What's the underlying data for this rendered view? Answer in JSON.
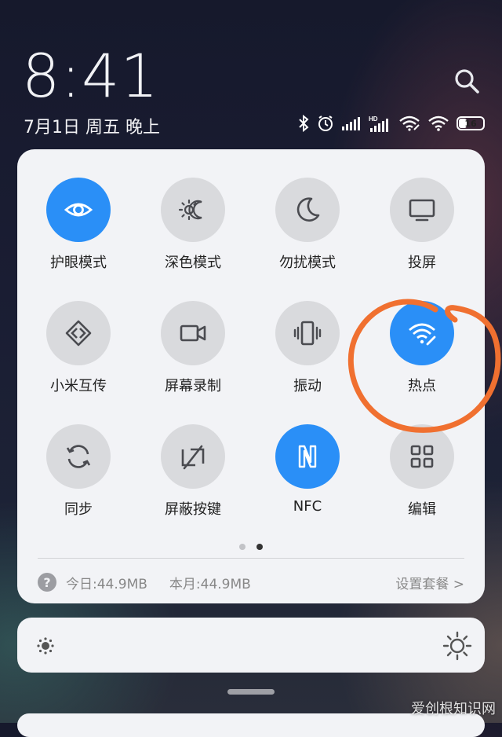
{
  "clock": {
    "time": "8:41",
    "date": "7月1日 周五 晚上"
  },
  "status": {
    "battery": "16",
    "battery_level": 0.16
  },
  "tiles": [
    {
      "id": "eye",
      "label": "护眼模式",
      "active": true,
      "icon": "eye-icon"
    },
    {
      "id": "dark",
      "label": "深色模式",
      "active": false,
      "icon": "dark-mode-icon"
    },
    {
      "id": "dnd",
      "label": "勿扰模式",
      "active": false,
      "icon": "moon-icon"
    },
    {
      "id": "cast",
      "label": "投屏",
      "active": false,
      "icon": "monitor-icon"
    },
    {
      "id": "share",
      "label": "小米互传",
      "active": false,
      "icon": "share-icon"
    },
    {
      "id": "record",
      "label": "屏幕录制",
      "active": false,
      "icon": "video-camera-icon"
    },
    {
      "id": "vibrate",
      "label": "振动",
      "active": false,
      "icon": "vibrate-icon"
    },
    {
      "id": "hotspot",
      "label": "热点",
      "active": true,
      "icon": "hotspot-icon"
    },
    {
      "id": "sync",
      "label": "同步",
      "active": false,
      "icon": "sync-icon"
    },
    {
      "id": "blockkeys",
      "label": "屏蔽按键",
      "active": false,
      "icon": "block-keys-icon"
    },
    {
      "id": "nfc",
      "label": "NFC",
      "active": true,
      "icon": "nfc-icon"
    },
    {
      "id": "edit",
      "label": "编辑",
      "active": false,
      "icon": "grid-icon"
    }
  ],
  "pager": {
    "count": 2,
    "active": 1
  },
  "data_usage": {
    "today": "今日:44.9MB",
    "month": "本月:44.9MB",
    "plan": "设置套餐 >"
  },
  "colors": {
    "accent": "#2a8ff7",
    "annotation": "#f07030"
  },
  "watermark": "爱创根知识网"
}
